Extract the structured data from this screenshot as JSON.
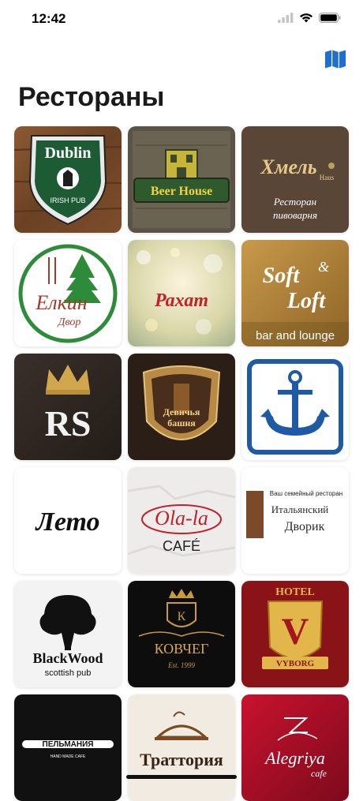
{
  "status_bar": {
    "time": "12:42"
  },
  "nav": {
    "map_icon": "map-icon"
  },
  "page": {
    "title": "Рестораны"
  },
  "restaurants": [
    {
      "name": "Dublin",
      "subtitle": "IRISH PUB"
    },
    {
      "name": "Beer House"
    },
    {
      "name": "Хмель",
      "subtitle": "Haus",
      "line1": "Ресторан",
      "line2": "пивоварня"
    },
    {
      "name": "Елкин",
      "subtitle": "Двор"
    },
    {
      "name": "Рахат"
    },
    {
      "name": "Soft",
      "amp": "&",
      "subtitle": "Loft",
      "tagline": "bar and lounge"
    },
    {
      "name": "RS"
    },
    {
      "name": "Девичья",
      "subtitle": "башня"
    },
    {
      "name": "anchor"
    },
    {
      "name": "Лето"
    },
    {
      "name": "Ola-la",
      "subtitle": "CAFÉ"
    },
    {
      "name": "Итальянский",
      "subtitle": "Дворик",
      "tagline": "Ваш семейный ресторан"
    },
    {
      "name": "BlackWood",
      "subtitle": "scottish pub"
    },
    {
      "name": "КОВЧЕГ",
      "subtitle": "Est. 1999",
      "letter": "К"
    },
    {
      "name": "HOTEL",
      "subtitle": "VYBORG",
      "letter": "V"
    },
    {
      "name": "ПЕЛЬМАНИЯ",
      "subtitle": "HAND MADE CAFE"
    },
    {
      "name": "Траттория"
    },
    {
      "name": "Alegriya",
      "subtitle": "cafe"
    }
  ]
}
